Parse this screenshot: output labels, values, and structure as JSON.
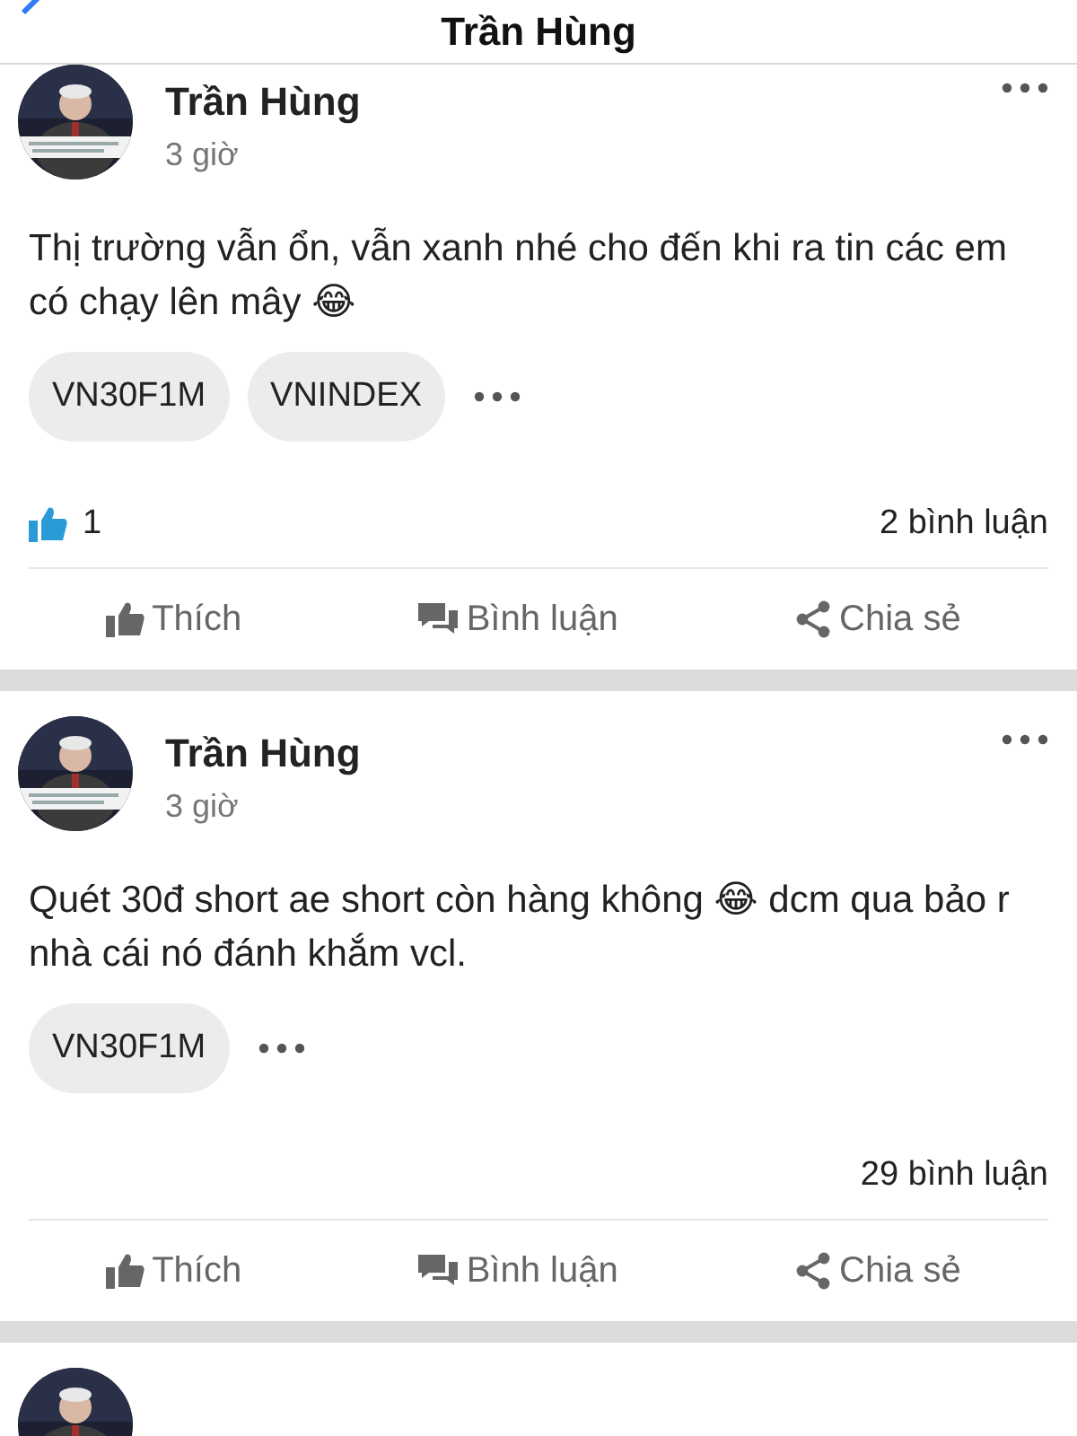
{
  "header": {
    "title": "Trần Hùng"
  },
  "posts": [
    {
      "author": "Trần Hùng",
      "time": "3 giờ",
      "text": "Thị trường vẫn ổn, vẫn xanh nhé cho đến khi ra tin các em có chạy lên mây 😂",
      "tags": [
        "VN30F1M",
        "VNINDEX"
      ],
      "likes": "1",
      "comments": "2 bình luận",
      "actions": [
        "Thích",
        "Bình luận",
        "Chia sẻ"
      ]
    },
    {
      "author": "Trần Hùng",
      "time": "3 giờ",
      "text": "Quét 30đ short ae short còn hàng không 😂 dcm qua bảo r nhà cái nó đánh khắm vcl.",
      "tags": [
        "VN30F1M"
      ],
      "comments": "29 bình luận",
      "actions": [
        "Thích",
        "Bình luận",
        "Chia sẻ"
      ]
    }
  ]
}
